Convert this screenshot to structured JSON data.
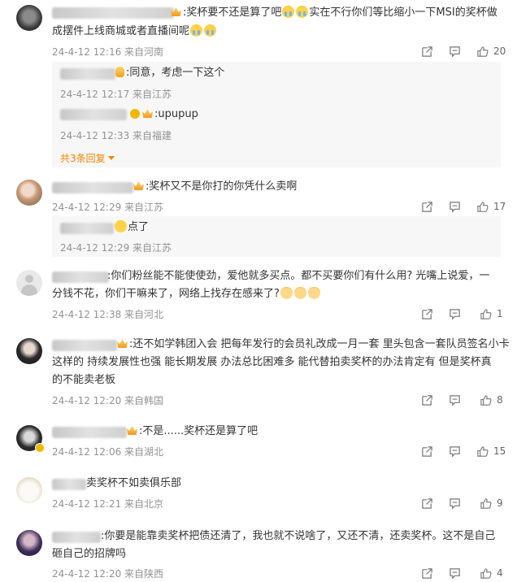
{
  "comments": [
    {
      "text": ":奖杯要不还是算了吧",
      "text2": "实在不行你们等比缩小一下MSI的奖杯做",
      "text3": "成摆件上线商城或者直播间呢",
      "meta": "24-4-12 12:16 来自河南",
      "likes": "20",
      "replies": [
        {
          "text": ":同意，考虑一下这个",
          "meta": "24-4-12 12:17 来自江苏"
        },
        {
          "text": ":upupup",
          "meta": "24-4-12 12:33 来自福建"
        }
      ],
      "more": "共3条回复"
    },
    {
      "text": ":奖杯又不是你打的你凭什么卖啊",
      "meta": "24-4-12 12:29 来自江苏",
      "likes": "17",
      "replies": [
        {
          "text": "点了",
          "meta": "24-4-12 12:29 来自江苏"
        }
      ]
    },
    {
      "text": ":你们粉丝能不能使使劲，爱他就多买点。都不买要你们有什么用? 光嘴上说爱，一",
      "text2": "分钱不花，你们干嘛来了，网络上找存在感来了?",
      "meta": "24-4-12 12:38 来自河北",
      "likes": "1"
    },
    {
      "text": ":还不如学韩团入会 把每年发行的会员礼改成一月一套 里头包含一套队员签名小卡",
      "text2": "这样的 持续发展性也强 能长期发展 办法总比困难多 能代替拍卖奖杯的办法肯定有 但是奖杯真",
      "text3": "的不能卖老板",
      "meta": "24-4-12 12:20 来自韩国",
      "likes": "8"
    },
    {
      "text": ":不是......奖杯还是算了吧",
      "meta": "24-4-12 12:06 来自湖北",
      "likes": "15"
    },
    {
      "text": "卖奖杯不如卖俱乐部",
      "meta": "24-4-12 12:21 来自北京",
      "likes": "9"
    },
    {
      "text": ":你要是能靠卖奖杯把债还清了，我也就不说啥了，又还不清，还卖奖杯。这不是自己",
      "text2": "砸自己的招牌吗",
      "meta": "24-4-12 12:20 来自陕西",
      "likes": "4"
    }
  ],
  "icons": {
    "share": "share-icon",
    "comment": "comment-icon",
    "like": "like-icon"
  },
  "colors": {
    "accent": "#ff8200",
    "meta": "#939393",
    "text": "#333333"
  }
}
